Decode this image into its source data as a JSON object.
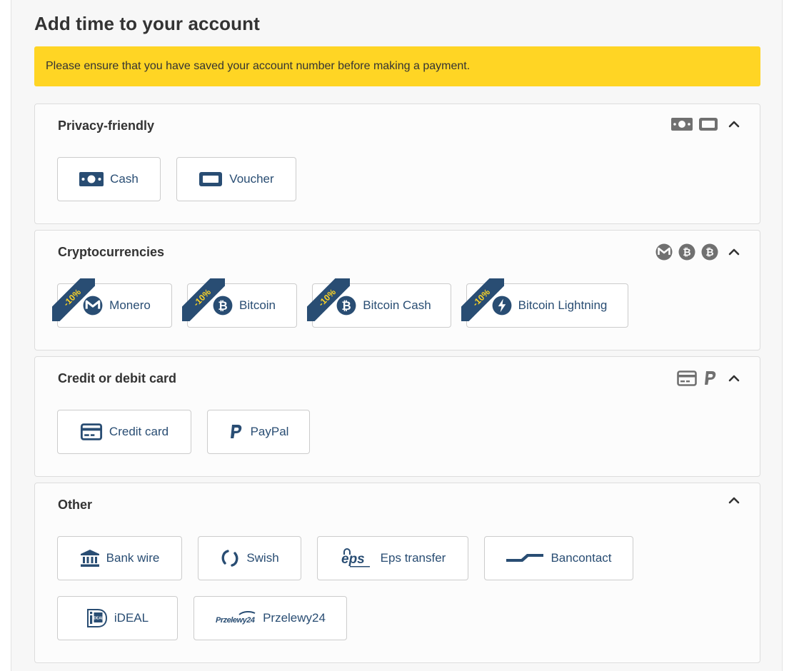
{
  "page": {
    "title": "Add time to your account",
    "notice": "Please ensure that you have saved your account number before making a payment."
  },
  "colors": {
    "accent": "#294d73",
    "notice_bg": "#ffd524",
    "discount_text": "#ffd524",
    "header_icon": "#707070"
  },
  "sections": [
    {
      "title": "Privacy-friendly",
      "header_icons": [
        "cash-icon",
        "voucher-icon"
      ],
      "methods": [
        {
          "label": "Cash",
          "icon": "cash-icon"
        },
        {
          "label": "Voucher",
          "icon": "voucher-icon"
        }
      ]
    },
    {
      "title": "Cryptocurrencies",
      "header_icons": [
        "monero-icon",
        "bitcoin-icon",
        "bitcoin-cash-icon"
      ],
      "methods": [
        {
          "label": "Monero",
          "icon": "monero-icon",
          "discount": "-10%"
        },
        {
          "label": "Bitcoin",
          "icon": "bitcoin-icon",
          "discount": "-10%"
        },
        {
          "label": "Bitcoin Cash",
          "icon": "bitcoin-cash-icon",
          "discount": "-10%"
        },
        {
          "label": "Bitcoin Lightning",
          "icon": "lightning-icon",
          "discount": "-10%"
        }
      ]
    },
    {
      "title": "Credit or debit card",
      "header_icons": [
        "credit-card-icon",
        "paypal-icon"
      ],
      "methods": [
        {
          "label": "Credit card",
          "icon": "credit-card-icon"
        },
        {
          "label": "PayPal",
          "icon": "paypal-icon"
        }
      ]
    },
    {
      "title": "Other",
      "header_icons": [],
      "methods": [
        {
          "label": "Bank wire",
          "icon": "bank-icon"
        },
        {
          "label": "Swish",
          "icon": "swish-icon"
        },
        {
          "label": "Eps transfer",
          "icon": "eps-icon",
          "logo_text": "eps"
        },
        {
          "label": "Bancontact",
          "icon": "bancontact-icon"
        },
        {
          "label": "iDEAL",
          "icon": "ideal-icon",
          "logo_text": "iDEAL"
        },
        {
          "label": "Przelewy24",
          "icon": "przelewy24-icon",
          "logo_text": "Przelewy24"
        }
      ]
    }
  ]
}
